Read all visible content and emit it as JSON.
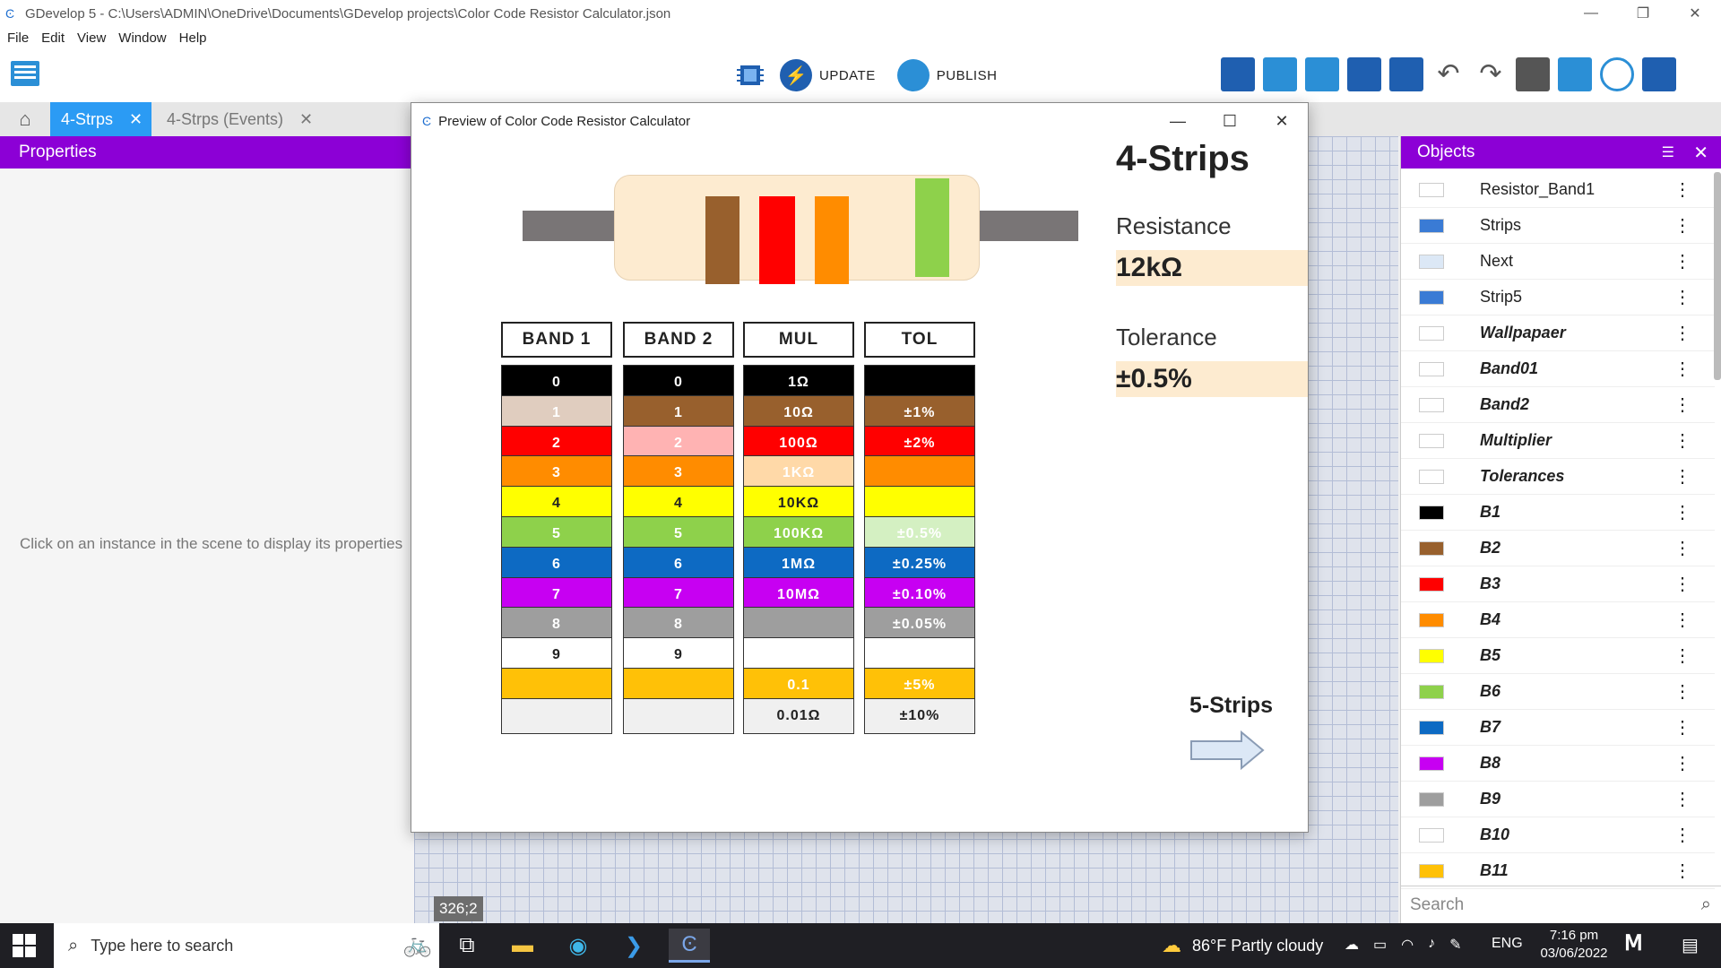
{
  "window": {
    "title": "GDevelop 5 - C:\\Users\\ADMIN\\OneDrive\\Documents\\GDevelop projects\\Color Code Resistor Calculator.json",
    "controls": [
      "—",
      "❐",
      "✕"
    ]
  },
  "menu": [
    "File",
    "Edit",
    "View",
    "Window",
    "Help"
  ],
  "toolbar": {
    "update_label": "UPDATE",
    "publish_label": "PUBLISH"
  },
  "tabs": [
    {
      "label": "4-Strps",
      "active": true
    },
    {
      "label": "4-Strps (Events)",
      "active": false
    }
  ],
  "properties": {
    "title": "Properties",
    "message": "Click on an instance in the scene to display its properties"
  },
  "scene": {
    "coords": "326;2"
  },
  "objects_panel": {
    "title": "Objects",
    "search_placeholder": "Search",
    "items": [
      {
        "name": "Resistor_Band1",
        "bold": false,
        "thumb": "#ffffff"
      },
      {
        "name": "Strips",
        "bold": false,
        "thumb": "#3a7bd5"
      },
      {
        "name": "Next",
        "bold": false,
        "thumb": "#dce8f6"
      },
      {
        "name": "Strip5",
        "bold": false,
        "thumb": "#3a7bd5"
      },
      {
        "name": "Wallpapaer",
        "bold": true,
        "thumb": "#ffffff"
      },
      {
        "name": "Band01",
        "bold": true,
        "thumb": "#ffffff"
      },
      {
        "name": "Band2",
        "bold": true,
        "thumb": "#ffffff"
      },
      {
        "name": "Multiplier",
        "bold": true,
        "thumb": "#ffffff"
      },
      {
        "name": "Tolerances",
        "bold": true,
        "thumb": "#ffffff"
      },
      {
        "name": "B1",
        "bold": true,
        "thumb": "#000000"
      },
      {
        "name": "B2",
        "bold": true,
        "thumb": "#98602d"
      },
      {
        "name": "B3",
        "bold": true,
        "thumb": "#ff0000"
      },
      {
        "name": "B4",
        "bold": true,
        "thumb": "#ff8c00"
      },
      {
        "name": "B5",
        "bold": true,
        "thumb": "#ffff00"
      },
      {
        "name": "B6",
        "bold": true,
        "thumb": "#8ed14b"
      },
      {
        "name": "B7",
        "bold": true,
        "thumb": "#0d6ac3"
      },
      {
        "name": "B8",
        "bold": true,
        "thumb": "#c700f2"
      },
      {
        "name": "B9",
        "bold": true,
        "thumb": "#9e9e9e"
      },
      {
        "name": "B10",
        "bold": true,
        "thumb": "#ffffff"
      },
      {
        "name": "B11",
        "bold": true,
        "thumb": "#ffc107"
      }
    ]
  },
  "preview": {
    "title": "Preview of Color Code Resistor Calculator",
    "heading": "4-Strips",
    "resistance_label": "Resistance",
    "resistance_value": "12kΩ",
    "tolerance_label": "Tolerance",
    "tolerance_value": "±0.5%",
    "next_label": "5-Strips",
    "resistor_bands": [
      "#98602d",
      "#ff0000",
      "#ff8c00",
      "#8ed14b"
    ],
    "columns": [
      {
        "header": "BAND 1",
        "cells": [
          {
            "t": "0",
            "bg": "#000000",
            "fg": "#ffffff"
          },
          {
            "t": "1",
            "bg": "#e0cdbf",
            "fg": "#ffffff"
          },
          {
            "t": "2",
            "bg": "#ff0000",
            "fg": "#ffffff"
          },
          {
            "t": "3",
            "bg": "#ff8c00",
            "fg": "#ffffff"
          },
          {
            "t": "4",
            "bg": "#ffff00",
            "fg": "#222222"
          },
          {
            "t": "5",
            "bg": "#8ed14b",
            "fg": "#ffffff"
          },
          {
            "t": "6",
            "bg": "#0d6ac3",
            "fg": "#ffffff"
          },
          {
            "t": "7",
            "bg": "#c700f2",
            "fg": "#ffffff"
          },
          {
            "t": "8",
            "bg": "#9e9e9e",
            "fg": "#ffffff"
          },
          {
            "t": "9",
            "bg": "#ffffff",
            "fg": "#222222"
          },
          {
            "t": "",
            "bg": "#ffc107",
            "fg": "#ffffff"
          },
          {
            "t": "",
            "bg": "#f0f0f0",
            "fg": "#222222"
          }
        ]
      },
      {
        "header": "BAND 2",
        "cells": [
          {
            "t": "0",
            "bg": "#000000",
            "fg": "#ffffff"
          },
          {
            "t": "1",
            "bg": "#98602d",
            "fg": "#ffffff"
          },
          {
            "t": "2",
            "bg": "#ffb3b3",
            "fg": "#ffffff"
          },
          {
            "t": "3",
            "bg": "#ff8c00",
            "fg": "#ffffff"
          },
          {
            "t": "4",
            "bg": "#ffff00",
            "fg": "#222222"
          },
          {
            "t": "5",
            "bg": "#8ed14b",
            "fg": "#ffffff"
          },
          {
            "t": "6",
            "bg": "#0d6ac3",
            "fg": "#ffffff"
          },
          {
            "t": "7",
            "bg": "#c700f2",
            "fg": "#ffffff"
          },
          {
            "t": "8",
            "bg": "#9e9e9e",
            "fg": "#ffffff"
          },
          {
            "t": "9",
            "bg": "#ffffff",
            "fg": "#222222"
          },
          {
            "t": "",
            "bg": "#ffc107",
            "fg": "#ffffff"
          },
          {
            "t": "",
            "bg": "#f0f0f0",
            "fg": "#222222"
          }
        ]
      },
      {
        "header": "MUL",
        "cells": [
          {
            "t": "1Ω",
            "bg": "#000000",
            "fg": "#ffffff"
          },
          {
            "t": "10Ω",
            "bg": "#98602d",
            "fg": "#ffffff"
          },
          {
            "t": "100Ω",
            "bg": "#ff0000",
            "fg": "#ffffff"
          },
          {
            "t": "1KΩ",
            "bg": "#ffd9a8",
            "fg": "#ffffff"
          },
          {
            "t": "10KΩ",
            "bg": "#ffff00",
            "fg": "#222222"
          },
          {
            "t": "100KΩ",
            "bg": "#8ed14b",
            "fg": "#ffffff"
          },
          {
            "t": "1MΩ",
            "bg": "#0d6ac3",
            "fg": "#ffffff"
          },
          {
            "t": "10MΩ",
            "bg": "#c700f2",
            "fg": "#ffffff"
          },
          {
            "t": "",
            "bg": "#9e9e9e",
            "fg": "#ffffff"
          },
          {
            "t": "",
            "bg": "#ffffff",
            "fg": "#222222"
          },
          {
            "t": "0.1",
            "bg": "#ffc107",
            "fg": "#ffffff"
          },
          {
            "t": "0.01Ω",
            "bg": "#f0f0f0",
            "fg": "#222222"
          }
        ]
      },
      {
        "header": "TOL",
        "cells": [
          {
            "t": "",
            "bg": "#000000",
            "fg": "#ffffff"
          },
          {
            "t": "±1%",
            "bg": "#98602d",
            "fg": "#ffffff"
          },
          {
            "t": "±2%",
            "bg": "#ff0000",
            "fg": "#ffffff"
          },
          {
            "t": "",
            "bg": "#ff8c00",
            "fg": "#ffffff"
          },
          {
            "t": "",
            "bg": "#ffff00",
            "fg": "#222222"
          },
          {
            "t": "±0.5%",
            "bg": "#d4f0c2",
            "fg": "#ffffff"
          },
          {
            "t": "±0.25%",
            "bg": "#0d6ac3",
            "fg": "#ffffff"
          },
          {
            "t": "±0.10%",
            "bg": "#c700f2",
            "fg": "#ffffff"
          },
          {
            "t": "±0.05%",
            "bg": "#9e9e9e",
            "fg": "#ffffff"
          },
          {
            "t": "",
            "bg": "#ffffff",
            "fg": "#222222"
          },
          {
            "t": "±5%",
            "bg": "#ffc107",
            "fg": "#ffffff"
          },
          {
            "t": "±10%",
            "bg": "#f0f0f0",
            "fg": "#222222"
          }
        ]
      }
    ]
  },
  "taskbar": {
    "search_placeholder": "Type here to search",
    "weather": "86°F  Partly cloudy",
    "lang": "ENG",
    "time": "7:16 pm",
    "date": "03/06/2022"
  }
}
